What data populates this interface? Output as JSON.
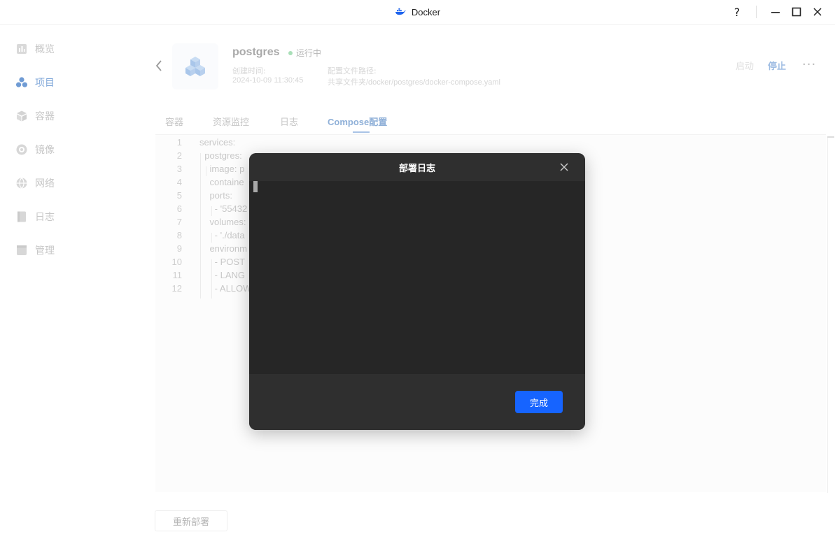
{
  "window": {
    "title": "Docker",
    "help_label": "?",
    "minimize_label": "—",
    "maximize_label": "☐",
    "close_label": "✕"
  },
  "sidebar": {
    "items": [
      {
        "label": "概览",
        "icon": "overview-icon",
        "active": false
      },
      {
        "label": "项目",
        "icon": "project-icon",
        "active": true
      },
      {
        "label": "容器",
        "icon": "container-icon",
        "active": false
      },
      {
        "label": "镜像",
        "icon": "image-icon",
        "active": false
      },
      {
        "label": "网络",
        "icon": "network-icon",
        "active": false
      },
      {
        "label": "日志",
        "icon": "log-icon",
        "active": false
      },
      {
        "label": "管理",
        "icon": "manage-icon",
        "active": false
      }
    ]
  },
  "project": {
    "name": "postgres",
    "status": "运行中",
    "created_label": "创建时间:",
    "created_value": "2024-10-09 11:30:45",
    "config_label": "配置文件路径:",
    "config_value": "共享文件夹/docker/postgres/docker-compose.yaml",
    "start_label": "启动",
    "stop_label": "停止",
    "more_label": "···"
  },
  "tabs": [
    {
      "label": "容器",
      "active": false
    },
    {
      "label": "资源监控",
      "active": false
    },
    {
      "label": "日志",
      "active": false
    },
    {
      "label": "Compose配置",
      "active": true
    }
  ],
  "editor": {
    "lines": [
      {
        "n": "1",
        "text": "services:"
      },
      {
        "n": "2",
        "text": "  postgres:"
      },
      {
        "n": "3",
        "text": "    image: p"
      },
      {
        "n": "4",
        "text": "    containe"
      },
      {
        "n": "5",
        "text": "    ports:"
      },
      {
        "n": "6",
        "text": "      - '55432"
      },
      {
        "n": "7",
        "text": "    volumes:"
      },
      {
        "n": "8",
        "text": "      - './data"
      },
      {
        "n": "9",
        "text": "    environm"
      },
      {
        "n": "10",
        "text": "      - POST"
      },
      {
        "n": "11",
        "text": "      - LANG"
      },
      {
        "n": "12",
        "text": "      - ALLOW"
      }
    ]
  },
  "redeploy_label": "重新部署",
  "modal": {
    "title": "部署日志",
    "close_label": "✕",
    "done_label": "完成"
  },
  "colors": {
    "accent": "#1664ff",
    "modal_bg": "#2a2a2a",
    "status_dot": "#a9dfb8"
  }
}
